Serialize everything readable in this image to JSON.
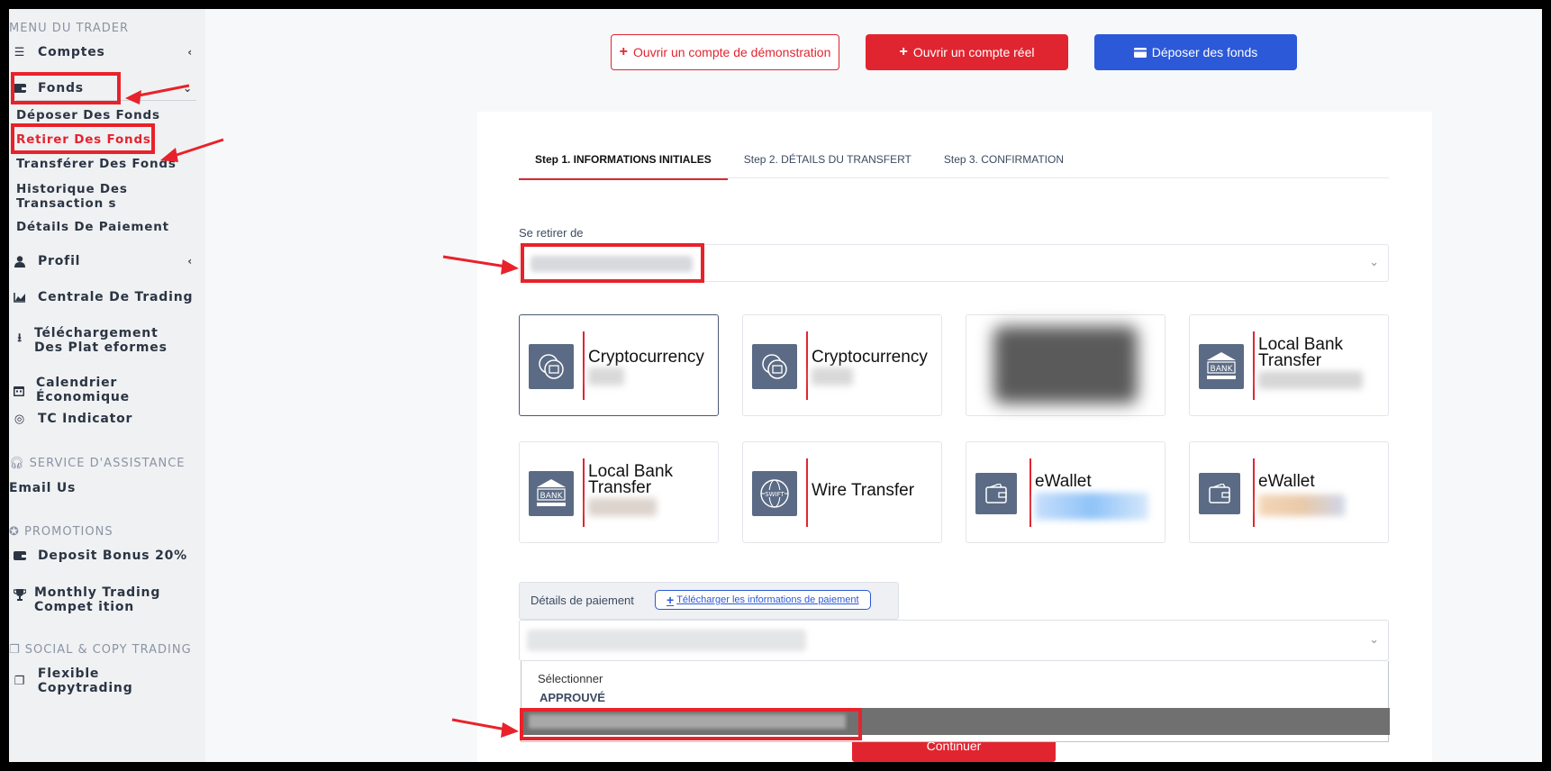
{
  "sidebar": {
    "menu_title": "MENU DU TRADER",
    "accounts": "Comptes",
    "funds": "Fonds",
    "funds_sub": [
      "Déposer Des Fonds",
      "Retirer Des Fonds",
      "Transférer Des Fonds",
      "Historique Des Transaction s",
      "Détails De Paiement"
    ],
    "profile": "Profil",
    "trading_center": "Centrale De Trading",
    "downloads": "Téléchargement Des Plat eformes",
    "calendar": "Calendrier Économique",
    "tc_indicator": "TC Indicator",
    "support_title": "SERVICE D'ASSISTANCE",
    "email_us": "Email Us",
    "promotions_title": "PROMOTIONS",
    "deposit_bonus": "Deposit Bonus 20%",
    "monthly_comp": "Monthly Trading Compet ition",
    "social_title": "SOCIAL & COPY TRADING",
    "copytrading": "Flexible Copytrading"
  },
  "header": {
    "demo_btn": "Ouvrir un compte de démonstration",
    "real_btn": "Ouvrir un compte réel",
    "deposit_btn": "Déposer des fonds"
  },
  "steps": {
    "step1": "Step 1. INFORMATIONS INITIALES",
    "step2": "Step 2. DÉTAILS DU TRANSFERT",
    "step3": "Step 3. CONFIRMATION"
  },
  "form": {
    "withdraw_from_label": "Se retirer de",
    "payment_details_label": "Détails de paiement",
    "upload_link": "Télécharger les informations de paiement",
    "dropdown_placeholder": "Sélectionner",
    "dropdown_group": "APPROUVÉ",
    "continue": "Continuer"
  },
  "methods": [
    {
      "title": "Cryptocurrency",
      "icon": "crypto-coins-icon"
    },
    {
      "title": "Cryptocurrency",
      "icon": "crypto-coins-icon"
    },
    {
      "title": "",
      "icon": "blurred-logo"
    },
    {
      "title": "Local Bank Transfer",
      "icon": "bank-icon"
    },
    {
      "title": "Local Bank Transfer",
      "icon": "bank-icon"
    },
    {
      "title": "Wire Transfer",
      "icon": "swift-globe-icon"
    },
    {
      "title": "eWallet",
      "icon": "wallet-icon"
    },
    {
      "title": "eWallet",
      "icon": "wallet-icon"
    }
  ],
  "colors": {
    "accent_red": "#e12530",
    "blue": "#2c59d8",
    "icon_bg": "#5b6b85"
  }
}
